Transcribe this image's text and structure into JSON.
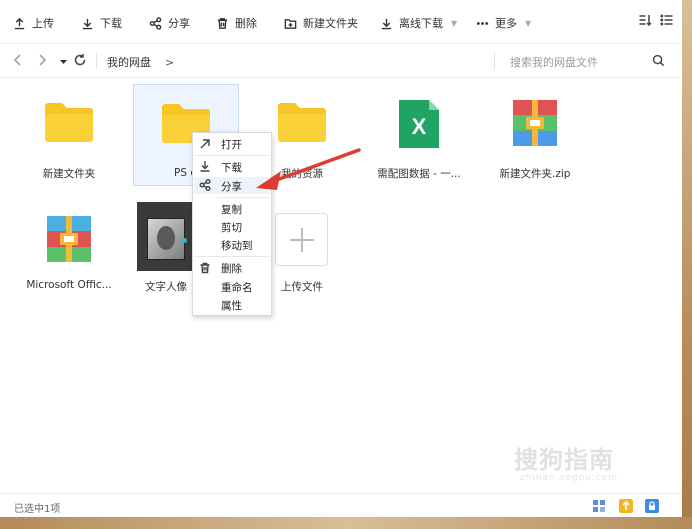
{
  "toolbar": {
    "upload_label": "上传",
    "download_label": "下载",
    "share_label": "分享",
    "delete_label": "删除",
    "new_folder_label": "新建文件夹",
    "offline_download_label": "离线下载",
    "more_label": "更多"
  },
  "addressbar": {
    "breadcrumb_root": "我的网盘",
    "breadcrumb_sep": ">",
    "search_placeholder": "搜索我的网盘文件"
  },
  "files": [
    {
      "label": "新建文件夹",
      "icon": "folder-icon"
    },
    {
      "label": "PS c",
      "icon": "folder-icon"
    },
    {
      "label": "我的资源",
      "icon": "folder-icon"
    },
    {
      "label": "需配图数据 - 一...",
      "icon": "excel-icon"
    },
    {
      "label": "新建文件夹.zip",
      "icon": "zip-icon"
    },
    {
      "label": "Microsoft Offic...",
      "icon": "zip-icon"
    },
    {
      "label": "文字人像",
      "icon": "image-thumbnail"
    },
    {
      "label": "上传文件",
      "icon": "add-icon"
    }
  ],
  "context_menu": {
    "open": "打开",
    "download": "下载",
    "share": "分享",
    "copy": "复制",
    "cut": "剪切",
    "move_to": "移动到",
    "delete": "删除",
    "rename": "重命名",
    "properties": "属性"
  },
  "statusbar": {
    "selection_text": "已选中1项"
  },
  "watermark": {
    "text": "搜狗指南",
    "sub": "zhinan.sogou.com"
  },
  "colors": {
    "folder": "#f7c625",
    "excel": "#1fa463",
    "arrow": "#e03b33",
    "selection_bg": "#eef4ff"
  }
}
